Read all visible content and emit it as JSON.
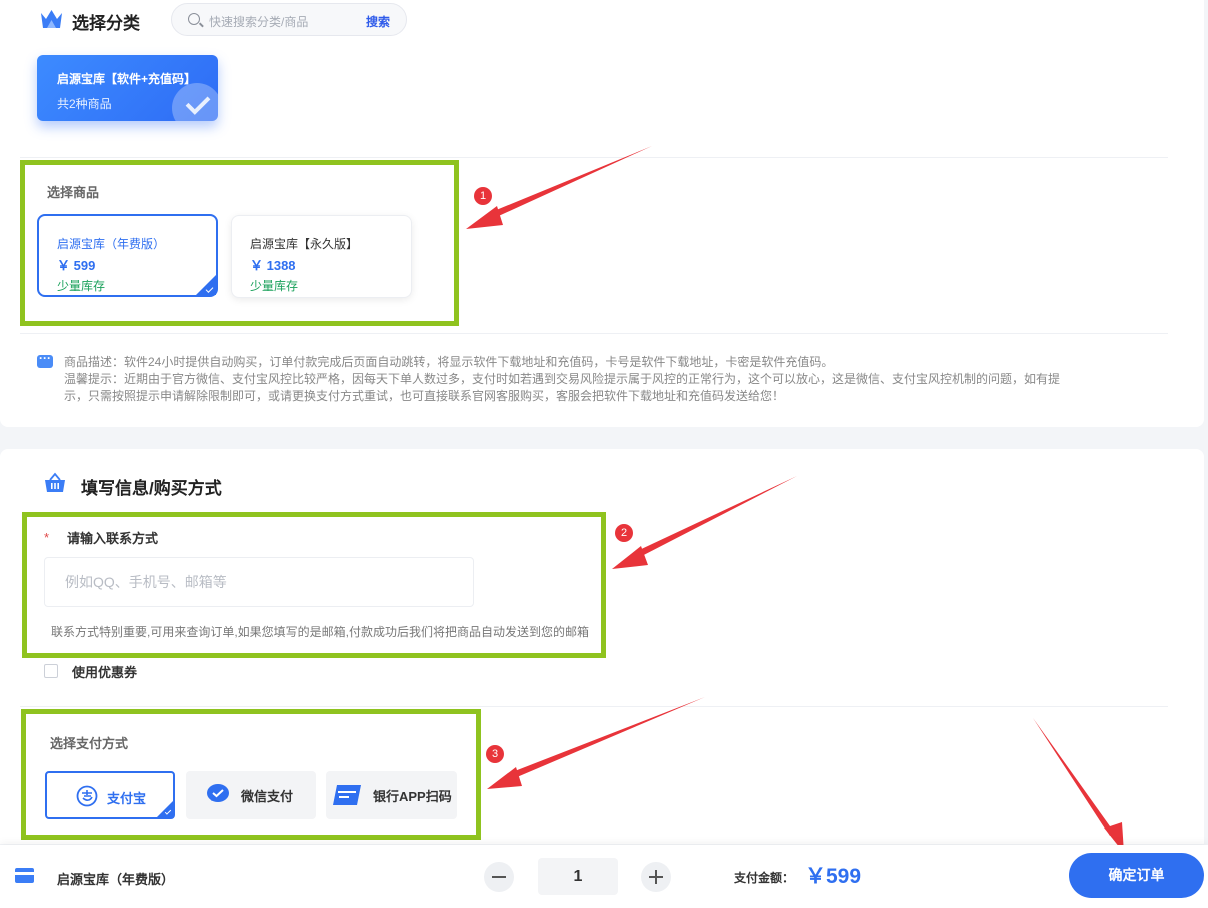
{
  "category_section": {
    "title": "选择分类",
    "search_placeholder": "快速搜索分类/商品",
    "search_button": "搜索",
    "categories": [
      {
        "name": "启源宝库【软件+充值码】",
        "count": "共2种商品",
        "selected": true
      }
    ]
  },
  "product_section": {
    "label": "选择商品",
    "products": [
      {
        "name": "启源宝库（年费版）",
        "price": "￥ 599",
        "stock": "少量库存",
        "selected": true
      },
      {
        "name": "启源宝库【永久版】",
        "price": "￥ 1388",
        "stock": "少量库存",
        "selected": false
      }
    ]
  },
  "description": {
    "line1": "商品描述：软件24小时提供自动购买，订单付款完成后页面自动跳转，将显示软件下载地址和充值码，卡号是软件下载地址，卡密是软件充值码。",
    "line2": "温馨提示：近期由于官方微信、支付宝风控比较严格，因每天下单人数过多，支付时如若遇到交易风险提示属于风控的正常行为，这个可以放心，这是微信、支付宝风控机制的问题，如有提示，只需按照提示申请解除限制即可，或请更换支付方式重试，也可直接联系官网客服购买，客服会把软件下载地址和充值码发送给您！"
  },
  "order_section": {
    "title": "填写信息/购买方式",
    "contact_required_mark": "*",
    "contact_label": "请输入联系方式",
    "contact_placeholder": "例如QQ、手机号、邮箱等",
    "contact_value": "",
    "contact_hint": "联系方式特别重要,可用来查询订单,如果您填写的是邮箱,付款成功后我们将把商品自动发送到您的邮箱",
    "coupon_label": "使用优惠券",
    "coupon_checked": false,
    "payment_label": "选择支付方式",
    "payment_methods": [
      {
        "name": "支付宝",
        "icon": "alipay-icon",
        "selected": true
      },
      {
        "name": "微信支付",
        "icon": "wechat-pay-icon",
        "selected": false
      },
      {
        "name": "银行APP扫码",
        "icon": "unionpay-icon",
        "selected": false
      }
    ]
  },
  "annotations": {
    "badges": [
      "1",
      "2",
      "3"
    ],
    "highlight_color": "#8fc31f",
    "arrow_color": "#e8343a"
  },
  "bottom_bar": {
    "product_name": "启源宝库（年费版）",
    "quantity": "1",
    "amount_label": "支付金额：",
    "amount": "￥599",
    "confirm_button": "确定订单"
  },
  "colors": {
    "accent": "#2f6ff0",
    "stock_green": "#19a05a",
    "background": "#f3f5f8"
  }
}
